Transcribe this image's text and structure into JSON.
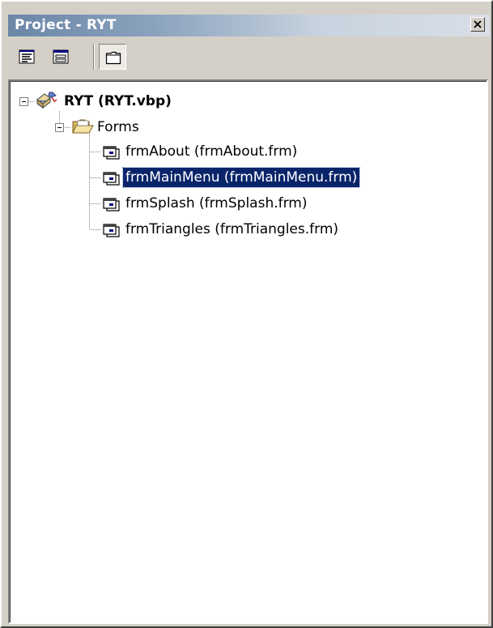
{
  "window": {
    "title": "Project - RYT",
    "close_glyph": "×"
  },
  "toolbar": {
    "buttons": [
      {
        "name": "view-code-icon",
        "pressed": false
      },
      {
        "name": "view-object-icon",
        "pressed": false
      },
      {
        "name": "toggle-folders-icon",
        "pressed": true
      }
    ]
  },
  "tree": {
    "project": {
      "label": "RYT (RYT.vbp)",
      "icon": "vb-project-icon",
      "expanded": true
    },
    "folder": {
      "label": "Forms",
      "icon": "folder-open-icon",
      "expanded": true
    },
    "forms": [
      {
        "label": "frmAbout (frmAbout.frm)",
        "icon": "form-icon",
        "selected": false
      },
      {
        "label": "frmMainMenu (frmMainMenu.frm)",
        "icon": "form-icon",
        "selected": true
      },
      {
        "label": "frmSplash (frmSplash.frm)",
        "icon": "form-icon",
        "selected": false
      },
      {
        "label": "frmTriangles (frmTriangles.frm)",
        "icon": "form-icon",
        "selected": false
      }
    ]
  },
  "colors": {
    "selection_bg": "#0a246a",
    "selection_fg": "#ffffff",
    "face": "#d4d0c8",
    "title_start": "#6b86a6",
    "title_end": "#d8dee6"
  }
}
